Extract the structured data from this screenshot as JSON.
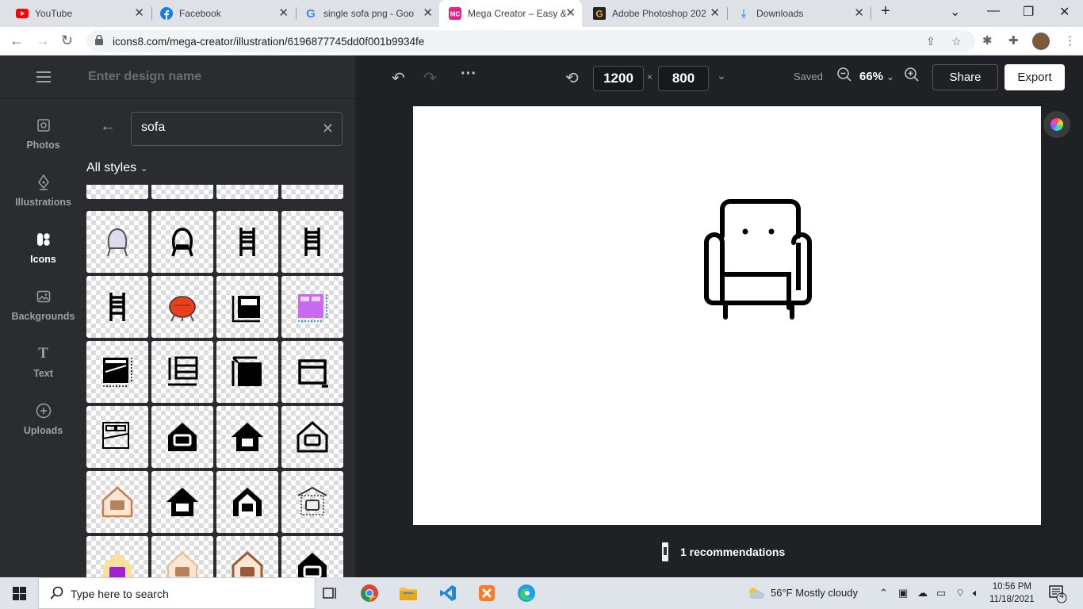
{
  "browser": {
    "tabs": [
      {
        "title": "YouTube",
        "icon": "youtube-icon",
        "color": "#ff0000"
      },
      {
        "title": "Facebook",
        "icon": "facebook-icon",
        "color": "#1877f2"
      },
      {
        "title": "single sofa png - Goo",
        "icon": "google-icon",
        "color": "#4285f4"
      },
      {
        "title": "Mega Creator – Easy &",
        "icon": "megacreator-icon",
        "color": "#e0248a"
      },
      {
        "title": "Adobe Photoshop 202",
        "icon": "getintopc-icon",
        "color": "#222222"
      },
      {
        "title": "Downloads",
        "icon": "download-icon",
        "color": "#1a73e8"
      }
    ],
    "url": "icons8.com/mega-creator/illustration/6196877745dd0f001b9934fe"
  },
  "sidebar": {
    "items": [
      {
        "label": "Photos",
        "icon": "photo-icon"
      },
      {
        "label": "Illustrations",
        "icon": "pen-nib-icon"
      },
      {
        "label": "Icons",
        "icon": "icons-icon"
      },
      {
        "label": "Backgrounds",
        "icon": "image-icon"
      },
      {
        "label": "Text",
        "icon": "text-icon"
      },
      {
        "label": "Uploads",
        "icon": "plus-circle-icon"
      }
    ]
  },
  "panel": {
    "design_name_placeholder": "Enter design name",
    "search_value": "sofa",
    "styles_label": "All styles"
  },
  "toolbar": {
    "width": "1200",
    "height": "800",
    "dim_separator": "×",
    "saved": "Saved",
    "zoom": "66%",
    "share": "Share",
    "export": "Export"
  },
  "recommendations": "1 recommendations",
  "taskbar": {
    "search_placeholder": "Type here to search",
    "weather": "56°F  Mostly cloudy",
    "time": "10:56 PM",
    "date": "11/18/2021",
    "notifications": "4"
  }
}
